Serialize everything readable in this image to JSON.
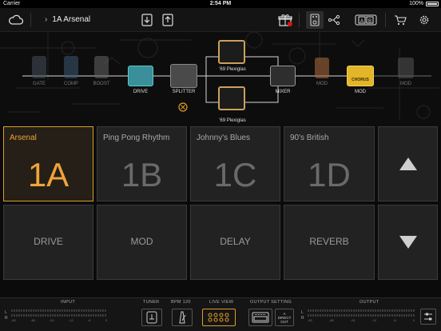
{
  "status": {
    "carrier": "Carrier",
    "time": "2:54 PM",
    "battery": "100%"
  },
  "toolbar": {
    "preset_title": "1A Arsenal",
    "chevron": "›"
  },
  "chain": {
    "labels": {
      "gate": "GATE",
      "comp": "COMP",
      "boost": "BOOST",
      "drive": "DRIVE",
      "splitter": "SPLITTER",
      "amp_a": "'69 Plexiglas",
      "amp_b": "'69 Plexiglas",
      "mixer": "MIXER",
      "mod_dim": "MOD",
      "mod": "MOD",
      "mod_right": "MOD"
    },
    "pedal_text": {
      "chorus": "CHORUS"
    }
  },
  "presets": [
    {
      "name": "Arsenal",
      "code": "1A",
      "active": true
    },
    {
      "name": "Ping Pong Rhythm",
      "code": "1B",
      "active": false
    },
    {
      "name": "Johnny's Blues",
      "code": "1C",
      "active": false
    },
    {
      "name": "90's British",
      "code": "1D",
      "active": false
    }
  ],
  "footswitches": [
    "DRIVE",
    "MOD",
    "DELAY",
    "REVERB"
  ],
  "bottom": {
    "input_label": "INPUT",
    "tuner_label": "TUNER",
    "bpm_label": "BPM 120",
    "live_view_label": "LIVE VIEW",
    "output_setting_label": "OUTPUT SETTING",
    "direct_out": "DIRECT OUT",
    "direct_a": "A",
    "output_label": "OUTPUT",
    "l": "L",
    "r": "R",
    "ticks": [
      "-60",
      "-48",
      "-24",
      "-12",
      "-6",
      "0"
    ]
  },
  "colors": {
    "accent": "#f0a43a",
    "tile": "#373737",
    "background": "#0b0b0b"
  }
}
